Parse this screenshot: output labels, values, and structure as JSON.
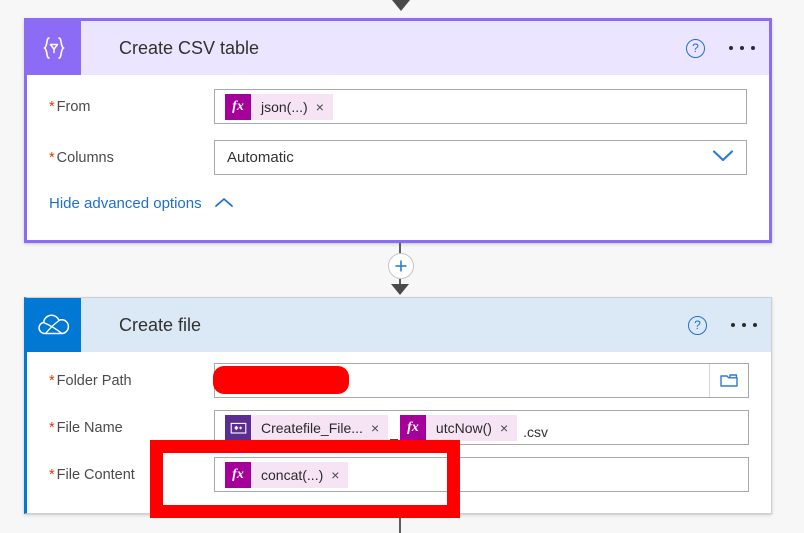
{
  "connectors": {
    "top_arrow": "arrow-down",
    "add_button_label": "+",
    "bottom_line": "vertical-connector"
  },
  "cards": [
    {
      "id": "create-csv-table",
      "title": "Create CSV table",
      "icon": "data-operations-icon",
      "accent": "#8c6cf4",
      "header_bg": "#ece5ff",
      "help_label": "?",
      "menu_label": "•••",
      "rows": [
        {
          "label": "From",
          "required": true,
          "type": "token",
          "tokens": [
            {
              "icon": "fx-icon",
              "icon_text": "fx",
              "icon_style": "fx",
              "text": "json(...)",
              "close": "×"
            }
          ]
        },
        {
          "label": "Columns",
          "required": true,
          "type": "dropdown",
          "value": "Automatic",
          "chevron": "chevron-down-icon"
        }
      ],
      "advanced_link": {
        "label": "Hide advanced options",
        "chevron": "chevron-up-icon"
      }
    },
    {
      "id": "create-file",
      "title": "Create file",
      "icon": "onedrive-cloud-icon",
      "accent": "#0078d4",
      "header_bg": "#dbe9f7",
      "help_label": "?",
      "menu_label": "•••",
      "rows": [
        {
          "label": "Folder Path",
          "required": true,
          "type": "redacted",
          "value": "",
          "trailing_icon": "folder-picker-icon"
        },
        {
          "label": "File Name",
          "required": true,
          "type": "token",
          "tokens": [
            {
              "icon": "dynamic-content-icon",
              "icon_text": "",
              "icon_style": "dyn",
              "text": "Createfile_File...",
              "close": "×"
            },
            {
              "icon": "fx-icon",
              "icon_text": "fx",
              "icon_style": "fx",
              "text": "utcNow()",
              "close": "×"
            }
          ],
          "separator": "_",
          "trailing_text": ".csv"
        },
        {
          "label": "File Content",
          "required": true,
          "type": "token",
          "highlighted": true,
          "tokens": [
            {
              "icon": "fx-icon",
              "icon_text": "fx",
              "icon_style": "fx",
              "text": "concat(...)",
              "close": "×"
            }
          ]
        }
      ]
    }
  ],
  "annotations": {
    "highlight_color": "#ff0000",
    "redaction_color": "#ff0000"
  }
}
